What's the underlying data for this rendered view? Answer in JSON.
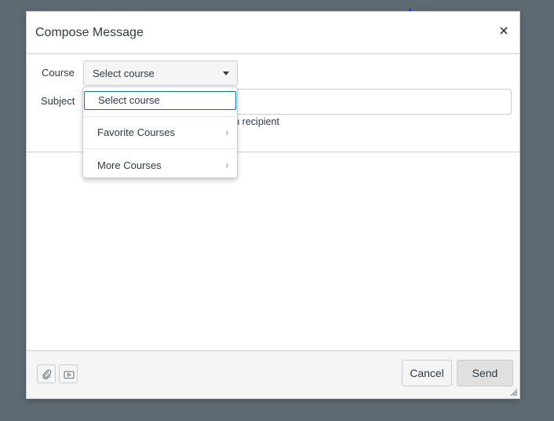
{
  "dialog": {
    "title": "Compose Message",
    "close_icon": "close-icon"
  },
  "form": {
    "course_label": "Course",
    "course_value": "Select course",
    "subject_label": "Subject",
    "subject_value": "",
    "hint_text": "ch recipient"
  },
  "dropdown": {
    "items": [
      {
        "label": "Select course",
        "selected": true,
        "has_submenu": false
      },
      {
        "label": "Favorite Courses",
        "selected": false,
        "has_submenu": true
      },
      {
        "label": "More Courses",
        "selected": false,
        "has_submenu": true
      }
    ]
  },
  "footer": {
    "attach_icon": "paperclip-icon",
    "media_icon": "media-icon",
    "cancel_label": "Cancel",
    "send_label": "Send"
  },
  "colors": {
    "overlay": "#5f6b72",
    "focus_border": "#0374b5",
    "text": "#2d3b45"
  }
}
